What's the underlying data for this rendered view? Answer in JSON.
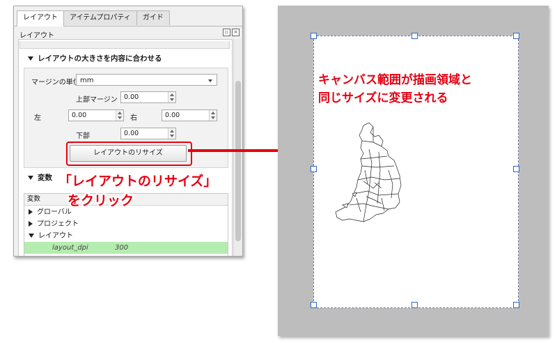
{
  "panel": {
    "tabs": [
      "レイアウト",
      "アイテムプロパティ",
      "ガイド"
    ],
    "dock_title": "レイアウト",
    "resize_section": {
      "heading": "レイアウトの大きさを内容に合わせる",
      "margin_unit_label": "マージンの単位",
      "margin_unit_value": "mm",
      "top_label": "上部マージン",
      "top_value": "0.00",
      "left_label": "左",
      "left_value": "0.00",
      "right_label": "右",
      "right_value": "0.00",
      "bottom_label": "下部",
      "bottom_value": "0.00",
      "resize_button": "レイアウトのリサイズ"
    },
    "variables_section": {
      "heading": "変数",
      "column_header": "変数",
      "rows": [
        {
          "label": "グローバル",
          "state": "collapsed"
        },
        {
          "label": "プロジェクト",
          "state": "collapsed"
        },
        {
          "label": "レイアウト",
          "state": "expanded"
        }
      ],
      "selected_var_name": "layout_dpi",
      "selected_var_value": "300"
    }
  },
  "annotations": {
    "left_line1": "「レイアウトのリサイズ」",
    "left_line2": "をクリック",
    "right_line1": "キャンバス範囲が描画領域と",
    "right_line2": "同じサイズに変更される"
  },
  "colors": {
    "annotation_red": "#e60012",
    "highlight_green": "#b5ecb0",
    "canvas_gray": "#bdbdbd"
  }
}
